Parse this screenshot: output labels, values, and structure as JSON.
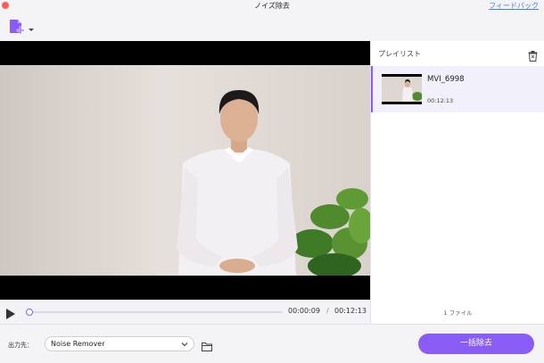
{
  "window": {
    "title": "ノイズ除去",
    "feedback_link": "フィードバック"
  },
  "toolbar": {
    "add_file_icon": "add-file-icon",
    "accent": "#8a5cf6"
  },
  "player": {
    "current_time": "00:00:09",
    "separator": "/",
    "total_time": "00:12:13",
    "progress": 0.012
  },
  "playlist": {
    "label": "プレイリスト",
    "items": [
      {
        "name": "MVI_6998",
        "duration": "00:12:13"
      }
    ],
    "file_count": "1 ファイル"
  },
  "output": {
    "label": "出力先：",
    "selected": "Noise Remover",
    "run_button": "一括除去"
  }
}
